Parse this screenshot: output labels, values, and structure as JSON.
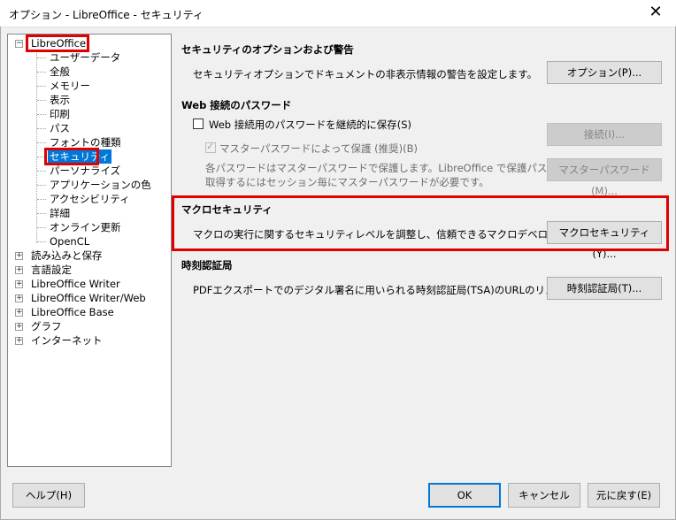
{
  "window": {
    "title": "オプション - LibreOffice - セキュリティ"
  },
  "tree": {
    "root": "LibreOffice",
    "children": [
      "ユーザーデータ",
      "全般",
      "メモリー",
      "表示",
      "印刷",
      "パス",
      "フォントの種類",
      "セキュリティ",
      "パーソナライズ",
      "アプリケーションの色",
      "アクセシビリティ",
      "詳細",
      "オンライン更新",
      "OpenCL"
    ],
    "selected": "セキュリティ",
    "groups": [
      "読み込みと保存",
      "言語設定",
      "LibreOffice Writer",
      "LibreOffice Writer/Web",
      "LibreOffice Base",
      "グラフ",
      "インターネット"
    ]
  },
  "security": {
    "options_title": "セキュリティのオプションおよび警告",
    "options_desc": "セキュリティオプションでドキュメントの非表示情報の警告を設定します。",
    "options_btn": "オプション(P)...",
    "pw_title": "Web 接続のパスワード",
    "pw_persist": "Web 接続用のパスワードを継続的に保存(S)",
    "pw_master": "マスターパスワードによって保護 (推奨)(B)",
    "pw_desc1": "各パスワードはマスターパスワードで保護します。LibreOffice で保護パスワードを",
    "pw_desc2": "取得するにはセッション毎にマスターパスワードが必要です。",
    "connections_btn": "接続(I)...",
    "master_btn": "マスターパスワード(M)...",
    "macro_title": "マクロセキュリティ",
    "macro_desc": "マクロの実行に関するセキュリティレベルを調整し、信頼できるマクロデベロッパー...",
    "macro_btn": "マクロセキュリティ(Y)...",
    "tsa_title": "時刻認証局",
    "tsa_desc": "PDFエクスポートでのデジタル署名に用いられる時刻認証局(TSA)のURLのリス...",
    "tsa_btn": "時刻認証局(T)..."
  },
  "footer": {
    "help": "ヘルプ(H)",
    "ok": "OK",
    "cancel": "キャンセル",
    "reset": "元に戻す(E)"
  },
  "colors": {
    "highlight": "#e00000",
    "selection": "#0078d7"
  }
}
